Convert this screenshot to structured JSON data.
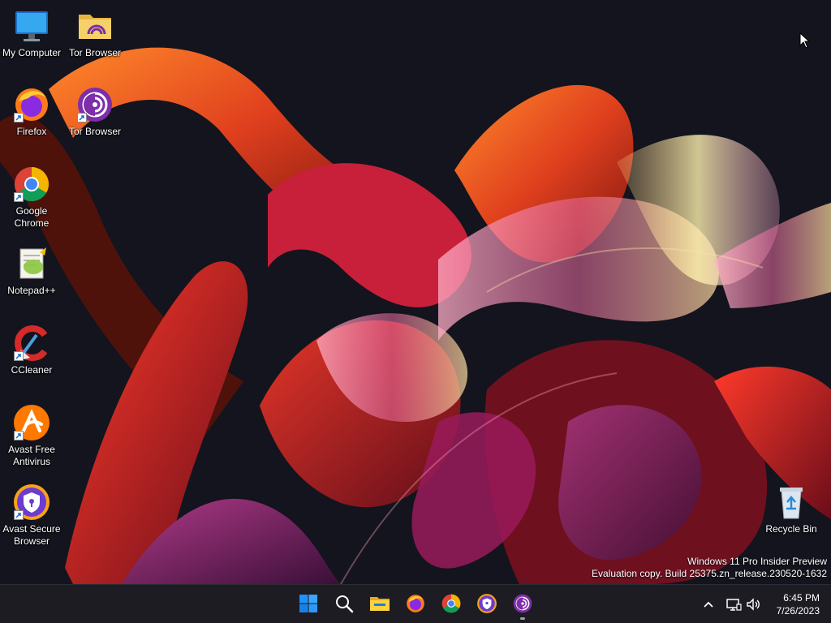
{
  "desktop": {
    "icons": [
      {
        "label": "My Computer",
        "icon": "monitor-icon"
      },
      {
        "label": "Tor Browser",
        "icon": "tor-folder-icon"
      },
      {
        "label": "Firefox",
        "icon": "firefox-icon"
      },
      {
        "label": "Tor Browser",
        "icon": "tor-browser-icon"
      },
      {
        "label": "Google Chrome",
        "icon": "chrome-icon"
      },
      {
        "label": "Notepad++",
        "icon": "notepadpp-icon"
      },
      {
        "label": "CCleaner",
        "icon": "ccleaner-icon"
      },
      {
        "label": "Avast Free Antivirus",
        "icon": "avast-antivirus-icon"
      },
      {
        "label": "Avast Secure Browser",
        "icon": "avast-browser-icon"
      },
      {
        "label": "Recycle Bin",
        "icon": "recycle-bin-icon"
      }
    ],
    "watermark": {
      "line1": "Windows 11 Pro Insider Preview",
      "line2": "Evaluation copy. Build 25375.zn_release.230520-1632"
    }
  },
  "taskbar": {
    "apps": [
      "start-icon",
      "search-icon",
      "file-explorer-icon",
      "firefox-icon",
      "chrome-icon",
      "avast-browser-icon",
      "tor-browser-icon"
    ],
    "tray": {
      "time": "6:45 PM",
      "date": "7/26/2023"
    }
  },
  "colors": {
    "taskbar_bg": "#1c1c22",
    "accent_blue": "#1e90ff"
  }
}
